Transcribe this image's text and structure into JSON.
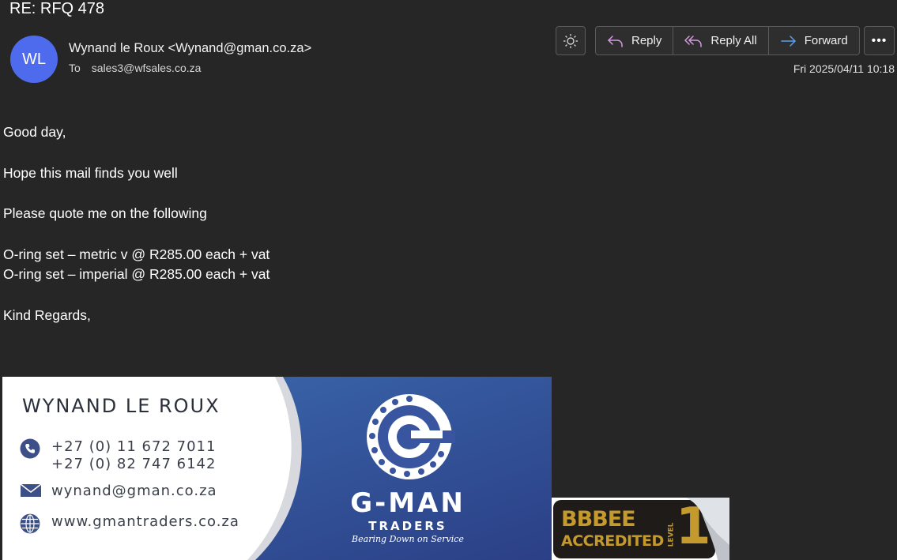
{
  "email": {
    "subject": "RE: RFQ 478",
    "avatar_initials": "WL",
    "avatar_color": "#4f6bed",
    "sender": "Wynand le Roux <Wynand@gman.co.za>",
    "to_label": "To",
    "to_address": "sales3@wfsales.co.za",
    "date": "Fri 2025/04/11 10:18"
  },
  "toolbar": {
    "theme_icon": "sun-icon",
    "reply": "Reply",
    "reply_all": "Reply All",
    "forward": "Forward",
    "more": "•••"
  },
  "body": {
    "greeting": "Good day,",
    "line1": "Hope this mail finds you well",
    "line2": "Please quote me on the following",
    "item1": "O-ring set – metric  v @ R285.00 each + vat",
    "item2": "O-ring set – imperial  @ R285.00 each + vat",
    "closing": "Kind Regards,"
  },
  "signature": {
    "name": "WYNAND LE ROUX",
    "phone1": "+27 (0) 11 672 7011",
    "phone2": "+27 (0) 82 747 6142",
    "email": "wynand@gman.co.za",
    "website": "www.gmantraders.co.za",
    "brand_main": "G-MAN",
    "brand_sub": "TRADERS",
    "brand_tagline": "Bearing Down on Service",
    "accent_color": "#2f4f93"
  },
  "badge": {
    "line1": "BBBEE",
    "line2": "ACCREDITED",
    "level_label": "LEVEL",
    "level_number": "1",
    "color": "#c49a2e"
  }
}
